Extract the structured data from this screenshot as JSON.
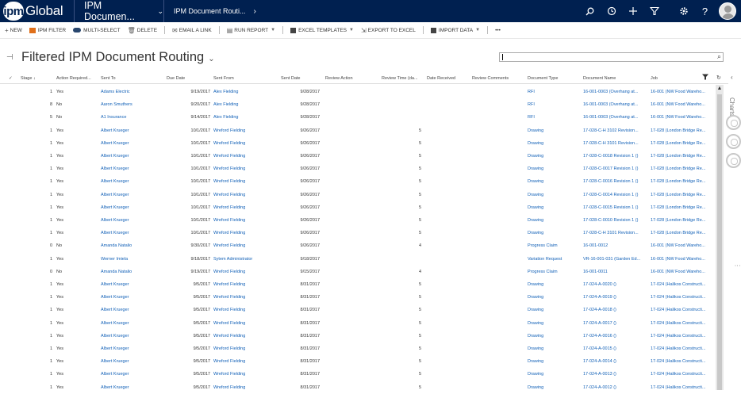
{
  "topnav": {
    "logo_mark": "ipm",
    "logo_word": "Global",
    "area": "IPM Documen...",
    "entity": "IPM Document Routi...",
    "icons": [
      "search-icon",
      "history-icon",
      "plus-icon",
      "filter-icon",
      "gear-icon",
      "help-icon",
      "user-avatar"
    ]
  },
  "commands": [
    {
      "label": "NEW",
      "icon": "plus"
    },
    {
      "label": "IPM FILTER",
      "icon": "orange-square"
    },
    {
      "label": "MULTI-SELECT",
      "icon": "pill"
    },
    {
      "label": "DELETE",
      "icon": "trash"
    },
    {
      "label": "EMAIL A LINK",
      "icon": "mail"
    },
    {
      "label": "RUN REPORT",
      "icon": "report"
    },
    {
      "label": "EXCEL TEMPLATES",
      "icon": "excel"
    },
    {
      "label": "EXPORT TO EXCEL",
      "icon": "excel"
    },
    {
      "label": "IMPORT DATA",
      "icon": "import"
    },
    {
      "label": "•••",
      "icon": "more"
    }
  ],
  "view": {
    "title": "Filtered IPM Document Routing",
    "search_value": ""
  },
  "columns": {
    "check": "✓",
    "stage": "Stage ↓",
    "action_required": "Action Required...",
    "sent_to": "Sent To",
    "due_date": "Due Date",
    "sent_from": "Sent From",
    "sent_date": "Sent Date",
    "review_action": "Review Action",
    "review_time": "Review Time (da...",
    "date_received": "Date Received",
    "review_comments": "Review Comments",
    "document_type": "Document Type",
    "document_name": "Document Name",
    "job": "Job"
  },
  "rows": [
    {
      "stage": "1",
      "action": "Yes",
      "sent_to": "Adams Electric",
      "due": "9/19/2017",
      "from": "Alex Fielding",
      "sent": "9/28/2017",
      "rt": "",
      "type": "RFI",
      "name": "16-001-0003 (Overhang at...",
      "job": "16-001 (NW Food Wareho..."
    },
    {
      "stage": "8",
      "action": "No",
      "sent_to": "Aaron Smuthers",
      "due": "9/20/2017",
      "from": "Alex Fielding",
      "sent": "9/28/2017",
      "rt": "",
      "type": "RFI",
      "name": "16-001-0003 (Overhang at...",
      "job": "16-001 (NW Food Wareho..."
    },
    {
      "stage": "5",
      "action": "No",
      "sent_to": "A1 Insurance",
      "due": "9/14/2017",
      "from": "Alex Fielding",
      "sent": "9/28/2017",
      "rt": "",
      "type": "RFI",
      "name": "16-001-0003 (Overhang at...",
      "job": "16-001 (NW Food Wareho..."
    },
    {
      "stage": "1",
      "action": "Yes",
      "sent_to": "Albert Krueger",
      "due": "10/1/2017",
      "from": "Wreford Fielding",
      "sent": "9/26/2017",
      "rt": "5",
      "type": "Drawing",
      "name": "17-028-C-H 3102 Revision...",
      "job": "17-028 (London Bridge Re..."
    },
    {
      "stage": "1",
      "action": "Yes",
      "sent_to": "Albert Krueger",
      "due": "10/1/2017",
      "from": "Wreford Fielding",
      "sent": "9/26/2017",
      "rt": "5",
      "type": "Drawing",
      "name": "17-028-C-H 3101 Revision...",
      "job": "17-028 (London Bridge Re..."
    },
    {
      "stage": "1",
      "action": "Yes",
      "sent_to": "Albert Krueger",
      "due": "10/1/2017",
      "from": "Wreford Fielding",
      "sent": "9/26/2017",
      "rt": "5",
      "type": "Drawing",
      "name": "17-028-C-0018 Revision 1 ()",
      "job": "17-028 (London Bridge Re..."
    },
    {
      "stage": "1",
      "action": "Yes",
      "sent_to": "Albert Krueger",
      "due": "10/1/2017",
      "from": "Wreford Fielding",
      "sent": "9/26/2017",
      "rt": "5",
      "type": "Drawing",
      "name": "17-028-C-0017 Revision 1 ()",
      "job": "17-028 (London Bridge Re..."
    },
    {
      "stage": "1",
      "action": "Yes",
      "sent_to": "Albert Krueger",
      "due": "10/1/2017",
      "from": "Wreford Fielding",
      "sent": "9/26/2017",
      "rt": "5",
      "type": "Drawing",
      "name": "17-028-C-0016 Revision 1 ()",
      "job": "17-028 (London Bridge Re..."
    },
    {
      "stage": "1",
      "action": "Yes",
      "sent_to": "Albert Krueger",
      "due": "10/1/2017",
      "from": "Wreford Fielding",
      "sent": "9/26/2017",
      "rt": "5",
      "type": "Drawing",
      "name": "17-028-C-0014 Revision 1 ()",
      "job": "17-028 (London Bridge Re..."
    },
    {
      "stage": "1",
      "action": "Yes",
      "sent_to": "Albert Krueger",
      "due": "10/1/2017",
      "from": "Wreford Fielding",
      "sent": "9/26/2017",
      "rt": "5",
      "type": "Drawing",
      "name": "17-028-C-0015 Revision 1 ()",
      "job": "17-028 (London Bridge Re..."
    },
    {
      "stage": "1",
      "action": "Yes",
      "sent_to": "Albert Krueger",
      "due": "10/1/2017",
      "from": "Wreford Fielding",
      "sent": "9/26/2017",
      "rt": "5",
      "type": "Drawing",
      "name": "17-028-C-0010 Revision 1 ()",
      "job": "17-028 (London Bridge Re..."
    },
    {
      "stage": "1",
      "action": "Yes",
      "sent_to": "Albert Krueger",
      "due": "10/1/2017",
      "from": "Wreford Fielding",
      "sent": "9/26/2017",
      "rt": "5",
      "type": "Drawing",
      "name": "17-028-C-H 3101 Revision...",
      "job": "17-028 (London Bridge Re..."
    },
    {
      "stage": "0",
      "action": "No",
      "sent_to": "Amanda Natalio",
      "due": "9/30/2017",
      "from": "Wreford Fielding",
      "sent": "9/26/2017",
      "rt": "4",
      "type": "Progress Claim",
      "name": "16-001-0012",
      "job": "16-001 (NW Food Wareho..."
    },
    {
      "stage": "1",
      "action": "Yes",
      "sent_to": "Werner Imiela",
      "due": "9/18/2017",
      "from": "Sytem Administrator",
      "sent": "9/18/2017",
      "rt": "",
      "type": "Variation Request",
      "name": "VR-16-001-031 (Garden Ed...",
      "job": "16-001 (NW Food Wareho..."
    },
    {
      "stage": "0",
      "action": "No",
      "sent_to": "Amanda Natalio",
      "due": "9/19/2017",
      "from": "Wreford Fielding",
      "sent": "9/15/2017",
      "rt": "4",
      "type": "Progress Claim",
      "name": "16-001-0011",
      "job": "16-001 (NW Food Wareho..."
    },
    {
      "stage": "1",
      "action": "Yes",
      "sent_to": "Albert Krueger",
      "due": "9/5/2017",
      "from": "Wreford Fielding",
      "sent": "8/31/2017",
      "rt": "5",
      "type": "Drawing",
      "name": "17-024-A-0020 ()",
      "job": "17-024 (Halikos Constructi..."
    },
    {
      "stage": "1",
      "action": "Yes",
      "sent_to": "Albert Krueger",
      "due": "9/5/2017",
      "from": "Wreford Fielding",
      "sent": "8/31/2017",
      "rt": "5",
      "type": "Drawing",
      "name": "17-024-A-0019 ()",
      "job": "17-024 (Halikos Constructi..."
    },
    {
      "stage": "1",
      "action": "Yes",
      "sent_to": "Albert Krueger",
      "due": "9/5/2017",
      "from": "Wreford Fielding",
      "sent": "8/31/2017",
      "rt": "5",
      "type": "Drawing",
      "name": "17-024-A-0018 ()",
      "job": "17-024 (Halikos Constructi..."
    },
    {
      "stage": "1",
      "action": "Yes",
      "sent_to": "Albert Krueger",
      "due": "9/5/2017",
      "from": "Wreford Fielding",
      "sent": "8/31/2017",
      "rt": "5",
      "type": "Drawing",
      "name": "17-024-A-0017 ()",
      "job": "17-024 (Halikos Constructi..."
    },
    {
      "stage": "1",
      "action": "Yes",
      "sent_to": "Albert Krueger",
      "due": "9/5/2017",
      "from": "Wreford Fielding",
      "sent": "8/31/2017",
      "rt": "5",
      "type": "Drawing",
      "name": "17-024-A-0016 ()",
      "job": "17-024 (Halikos Constructi..."
    },
    {
      "stage": "1",
      "action": "Yes",
      "sent_to": "Albert Krueger",
      "due": "9/5/2017",
      "from": "Wreford Fielding",
      "sent": "8/31/2017",
      "rt": "5",
      "type": "Drawing",
      "name": "17-024-A-0015 ()",
      "job": "17-024 (Halikos Constructi..."
    },
    {
      "stage": "1",
      "action": "Yes",
      "sent_to": "Albert Krueger",
      "due": "9/5/2017",
      "from": "Wreford Fielding",
      "sent": "8/31/2017",
      "rt": "5",
      "type": "Drawing",
      "name": "17-024-A-0014 ()",
      "job": "17-024 (Halikos Constructi..."
    },
    {
      "stage": "1",
      "action": "Yes",
      "sent_to": "Albert Krueger",
      "due": "9/5/2017",
      "from": "Wreford Fielding",
      "sent": "8/31/2017",
      "rt": "5",
      "type": "Drawing",
      "name": "17-024-A-0013 ()",
      "job": "17-024 (Halikos Constructi..."
    },
    {
      "stage": "1",
      "action": "Yes",
      "sent_to": "Albert Krueger",
      "due": "9/5/2017",
      "from": "Wreford Fielding",
      "sent": "8/31/2017",
      "rt": "5",
      "type": "Drawing",
      "name": "17-024-A-0012 ()",
      "job": "17-024 (Halikos Constructi..."
    }
  ],
  "side": {
    "collapse_glyph": "‹",
    "charts_label": "Charts",
    "more_glyph": "⋮"
  },
  "colors": {
    "nav": "#002050",
    "link": "#1160b7"
  }
}
